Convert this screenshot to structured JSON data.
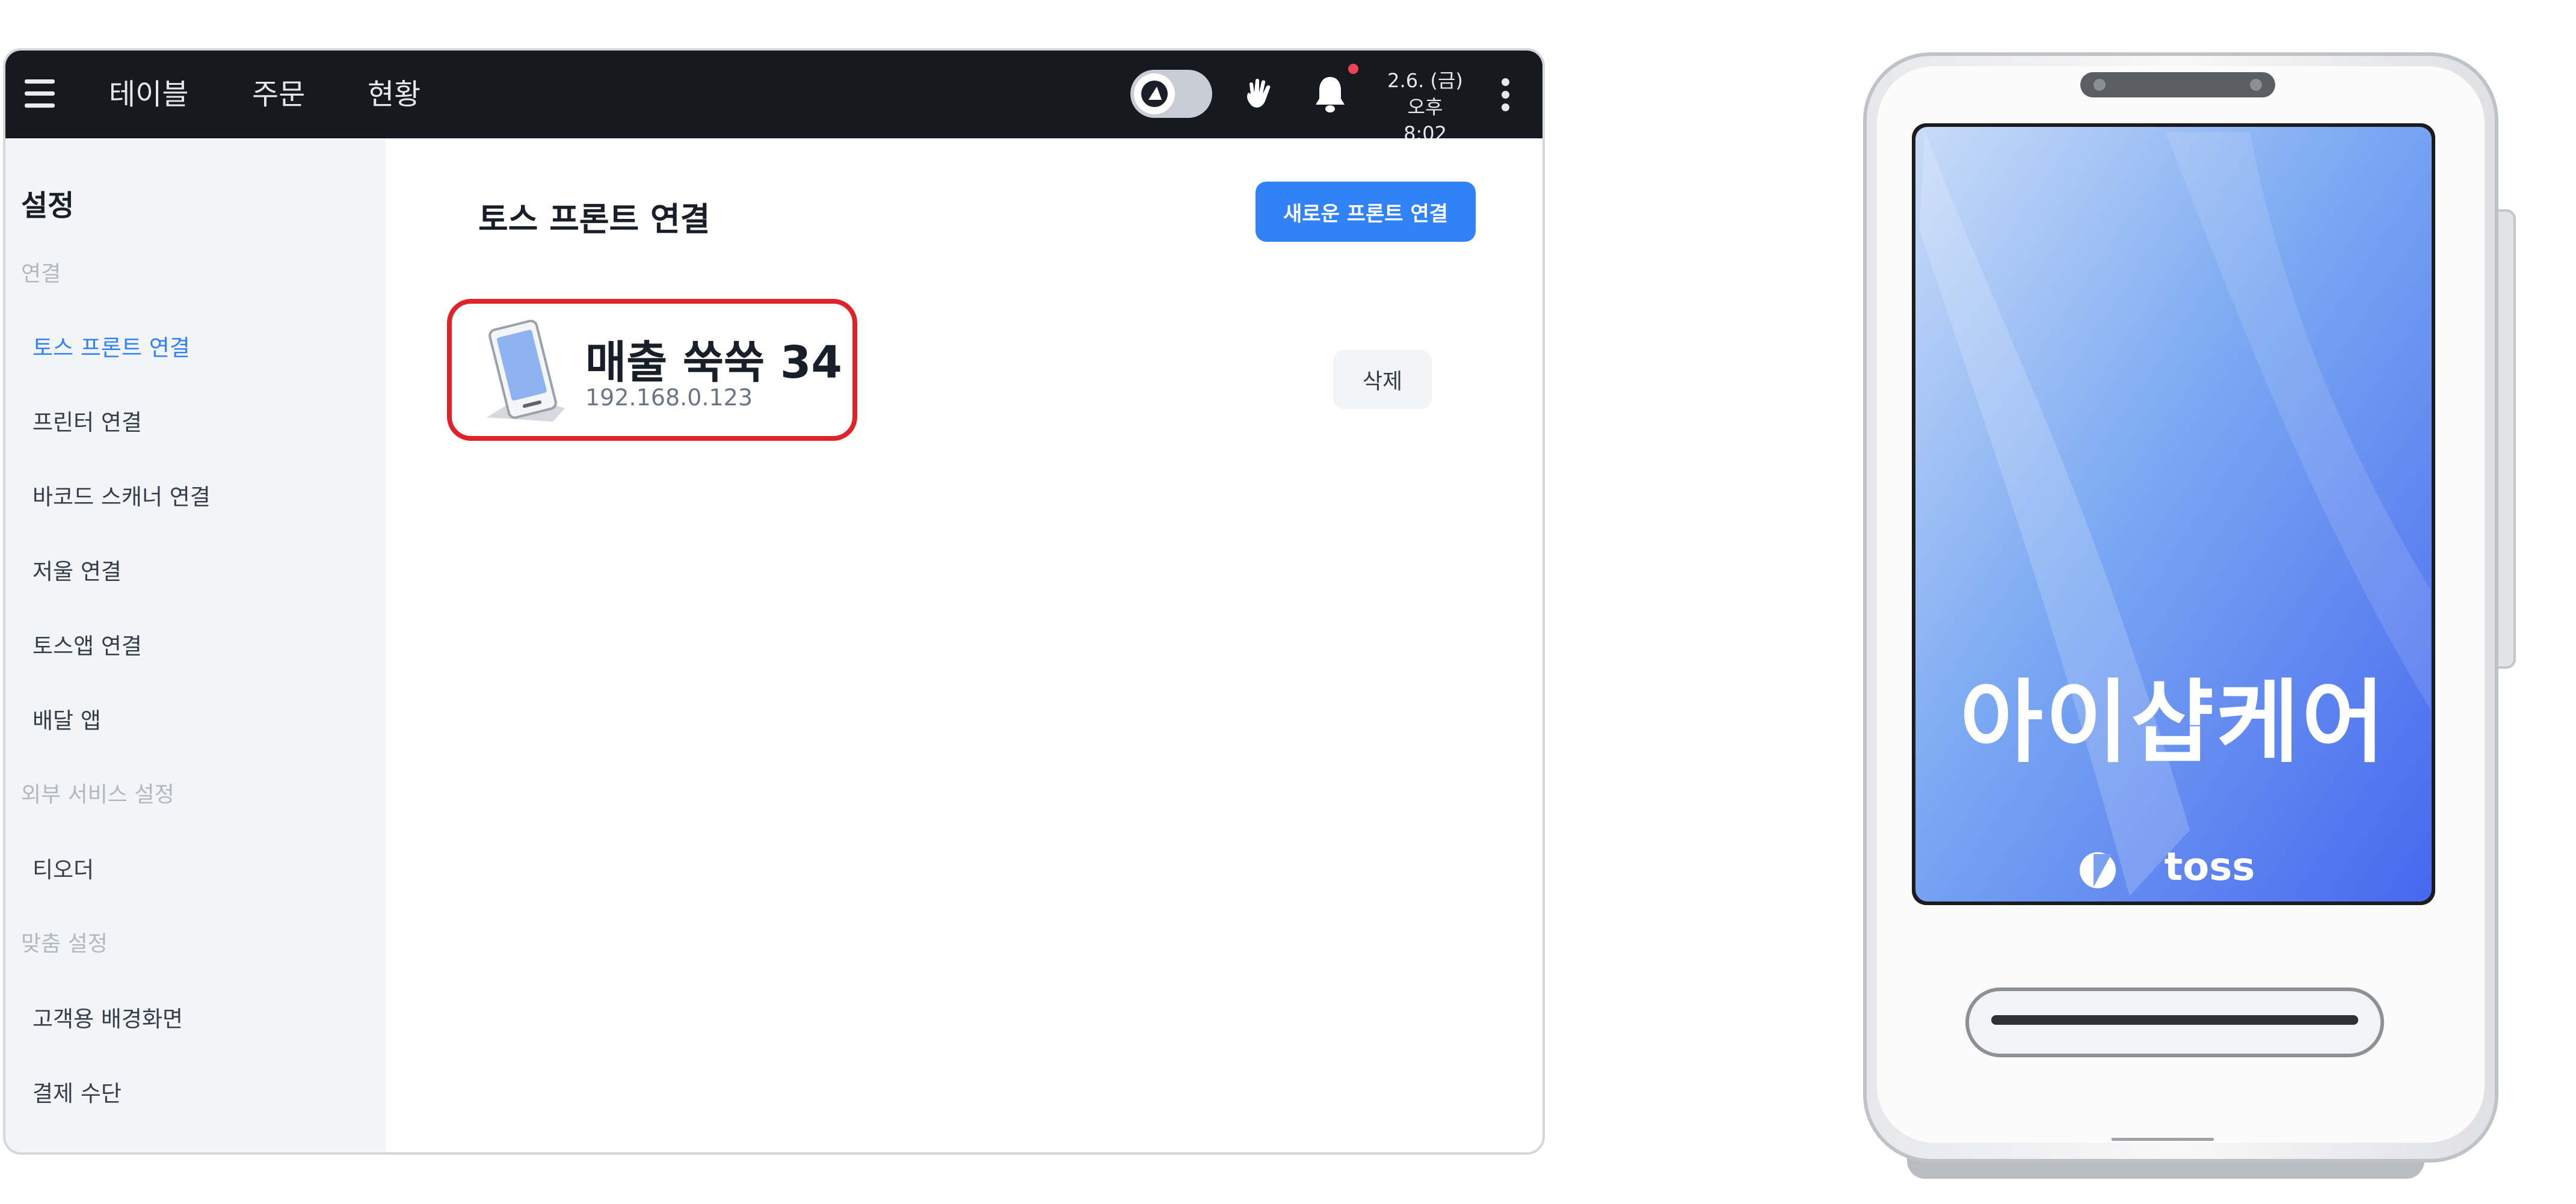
{
  "pos": {
    "topbar": {
      "nav": [
        "테이블",
        "주문",
        "현황"
      ],
      "date": "2.6. (금)",
      "time": "오후 8:02"
    },
    "sidebar": {
      "title": "설정",
      "sections": [
        {
          "label": "연결",
          "items": [
            {
              "label": "토스 프론트 연결",
              "active": true
            },
            {
              "label": "프린터 연결"
            },
            {
              "label": "바코드 스캐너 연결"
            },
            {
              "label": "저울 연결"
            },
            {
              "label": "토스앱 연결"
            },
            {
              "label": "배달 앱"
            }
          ]
        },
        {
          "label": "외부 서비스 설정",
          "items": [
            {
              "label": "티오더"
            }
          ]
        },
        {
          "label": "맞춤 설정",
          "items": [
            {
              "label": "고객용 배경화면"
            },
            {
              "label": "결제 수단"
            }
          ]
        }
      ]
    },
    "main": {
      "title": "토스 프론트 연결",
      "new_button": "새로운 프론트 연결",
      "device": {
        "name": "매출 쑥쑥 34",
        "ip": "192.168.0.123"
      },
      "delete_button": "삭제"
    }
  },
  "device_preview": {
    "screen_text": "아이샵케어",
    "brand": "toss"
  },
  "colors": {
    "topbar": "#16191f",
    "accent": "#3182f6",
    "highlight": "#e02329",
    "sidebar_bg": "#f2f4f6",
    "screen_gradient": [
      "#c7d9f7",
      "#6f9ff2",
      "#4f6ff0"
    ]
  },
  "icons": [
    "menu-icon",
    "toggle-icon",
    "hand-icon",
    "bell-icon",
    "kebab-icon",
    "device-icon",
    "toss-logo-icon"
  ]
}
